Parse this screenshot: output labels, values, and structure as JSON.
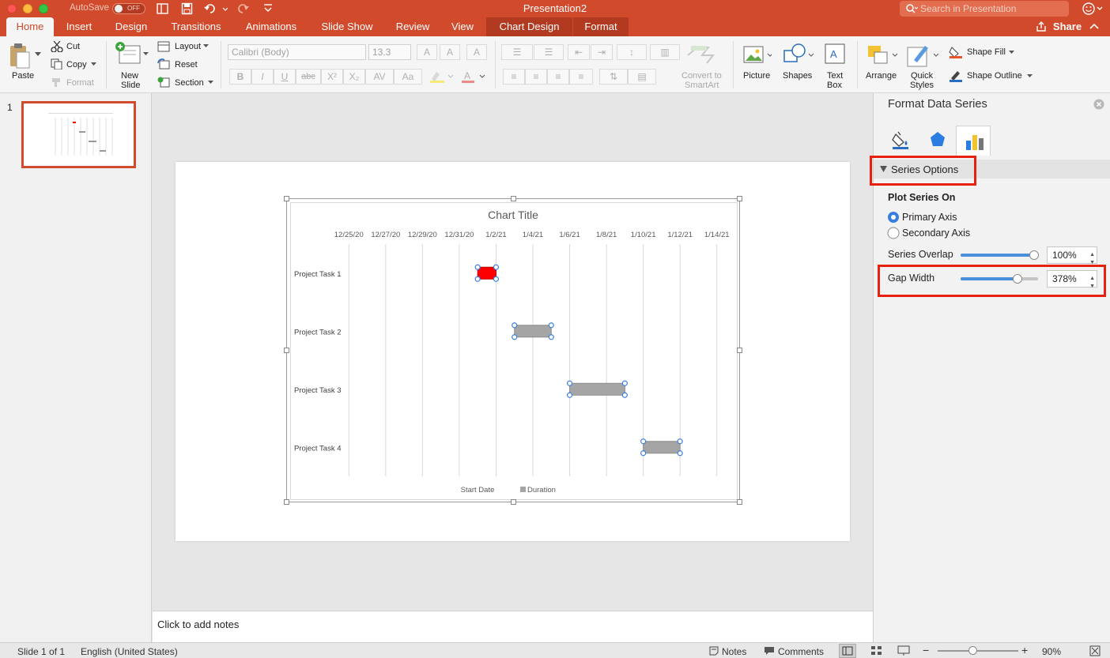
{
  "titlebar": {
    "autosave_label": "AutoSave",
    "autosave_state": "OFF",
    "doc_title": "Presentation2",
    "search_placeholder": "Search in Presentation"
  },
  "tabs": [
    "Home",
    "Insert",
    "Design",
    "Transitions",
    "Animations",
    "Slide Show",
    "Review",
    "View",
    "Chart Design",
    "Format"
  ],
  "share_label": "Share",
  "ribbon": {
    "paste": "Paste",
    "cut": "Cut",
    "copy": "Copy",
    "format": "Format",
    "new_slide": [
      "New",
      "Slide"
    ],
    "layout": "Layout",
    "reset": "Reset",
    "section": "Section",
    "font_name": "Calibri (Body)",
    "font_size": "13.3",
    "convert_smartart": [
      "Convert to",
      "SmartArt"
    ],
    "picture": "Picture",
    "shapes": "Shapes",
    "text_box": [
      "Text",
      "Box"
    ],
    "arrange": "Arrange",
    "quick_styles": [
      "Quick",
      "Styles"
    ],
    "shape_fill": "Shape Fill",
    "shape_outline": "Shape Outline"
  },
  "thumbnail": {
    "number": "1"
  },
  "chart": {
    "title": "Chart Title",
    "legend": [
      "Start Date",
      "Duration"
    ]
  },
  "chart_data": {
    "type": "bar",
    "orientation": "horizontal",
    "stacked": true,
    "title": "Chart Title",
    "x_axis_position": "top",
    "x_tick_labels": [
      "12/25/20",
      "12/27/20",
      "12/29/20",
      "12/31/20",
      "1/2/21",
      "1/4/21",
      "1/6/21",
      "1/8/21",
      "1/10/21",
      "1/12/21",
      "1/14/21"
    ],
    "xlim": [
      "2020-12-24",
      "2021-01-15"
    ],
    "grid": true,
    "legend_position": "bottom",
    "categories": [
      "Project Task 1",
      "Project Task 2",
      "Project Task 3",
      "Project Task 4"
    ],
    "series": [
      {
        "name": "Start Date",
        "values": [
          "2021-01-01",
          "2021-01-03",
          "2021-01-06",
          "2021-01-10"
        ],
        "visible": false
      },
      {
        "name": "Duration",
        "values": [
          1,
          2,
          3,
          2
        ],
        "color": "#a5a5a5",
        "highlight": {
          "index": 0,
          "color": "#ff0000"
        }
      }
    ]
  },
  "notes_placeholder": "Click to add notes",
  "pane": {
    "title": "Format Data Series",
    "section": "Series Options",
    "plot_series_on": "Plot Series On",
    "primary_axis": "Primary Axis",
    "secondary_axis": "Secondary Axis",
    "overlap_label": "Series Overlap",
    "overlap_value": "100%",
    "overlap_level": 1.0,
    "gap_label": "Gap Width",
    "gap_value": "378%",
    "gap_level": 0.76,
    "highlight_color": "#e8200f"
  },
  "status": {
    "slide": "Slide 1 of 1",
    "language": "English (United States)",
    "notes": "Notes",
    "comments": "Comments",
    "zoom": "90%"
  },
  "colors": {
    "brand": "#d04a2b",
    "accent": "#4a8fdc"
  }
}
